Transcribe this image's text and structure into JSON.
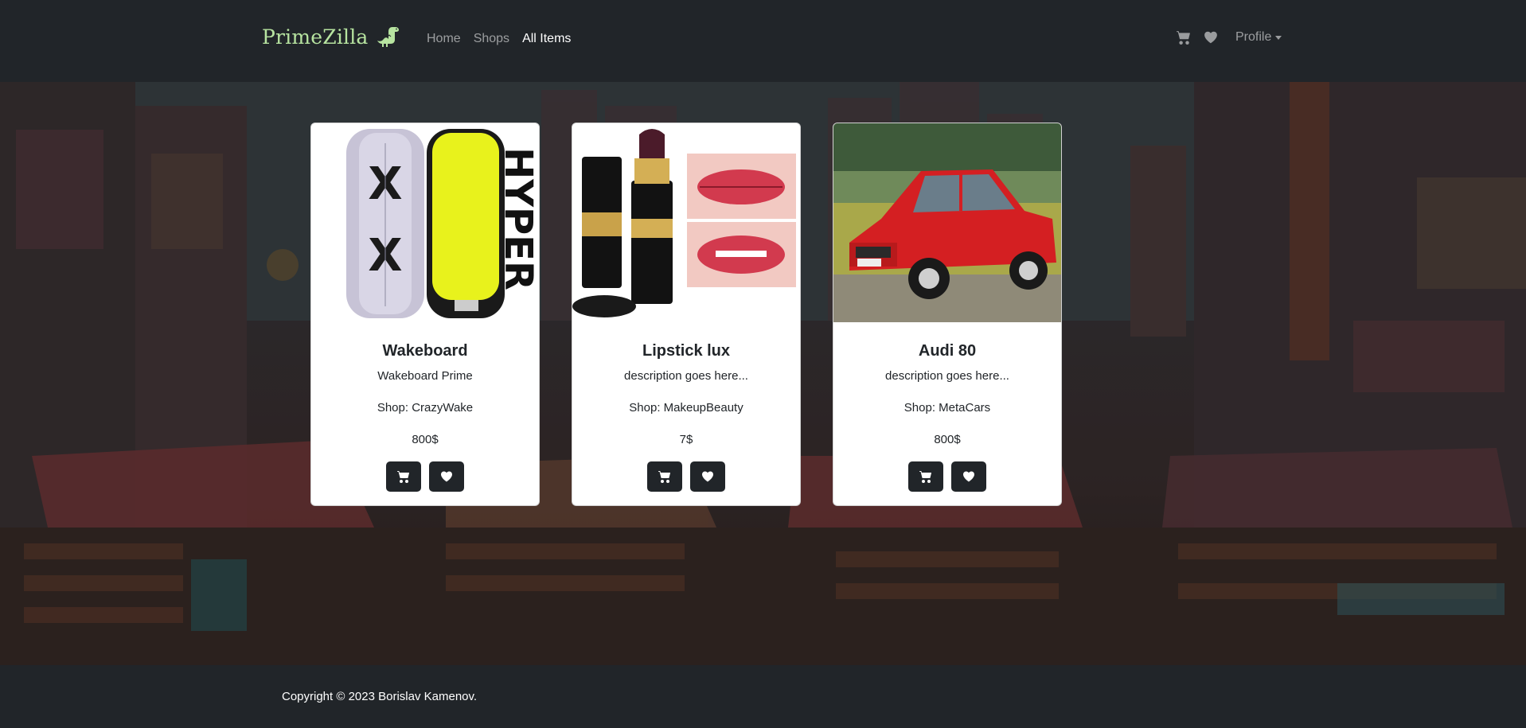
{
  "brand": {
    "name": "PrimeZilla",
    "color": "#b7e4a0"
  },
  "nav": {
    "links": [
      {
        "label": "Home",
        "active": false
      },
      {
        "label": "Shops",
        "active": false
      },
      {
        "label": "All Items",
        "active": true
      }
    ],
    "cart_icon": "cart-icon",
    "favorites_icon": "heart-icon",
    "profile_label": "Profile"
  },
  "items": [
    {
      "title": "Wakeboard",
      "description": "Wakeboard Prime",
      "shop": "Shop: CrazyWake",
      "price": "800$",
      "image": "wakeboard-image"
    },
    {
      "title": "Lipstick lux",
      "description": "description goes here...",
      "shop": "Shop: MakeupBeauty",
      "price": "7$",
      "image": "lipstick-image"
    },
    {
      "title": "Audi 80",
      "description": "description goes here...",
      "shop": "Shop: MetaCars",
      "price": "800$",
      "image": "car-image"
    }
  ],
  "footer": {
    "copyright": "Copyright © 2023 Borislav Kamenov."
  },
  "colors": {
    "navbar": "#212529",
    "button": "#212529",
    "card": "#ffffff"
  }
}
